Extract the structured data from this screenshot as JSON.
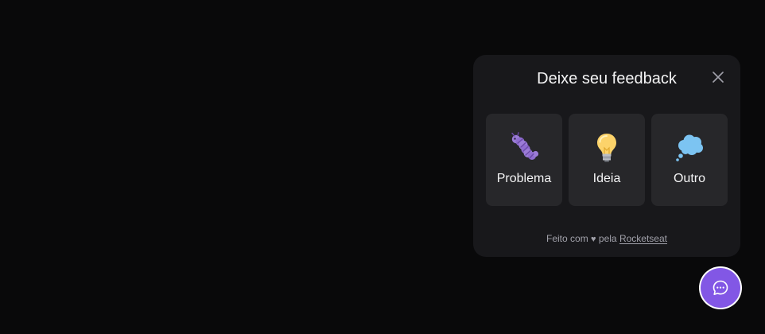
{
  "widget": {
    "title": "Deixe seu feedback",
    "close_icon": "close-icon",
    "options": [
      {
        "label": "Problema",
        "icon": "bug-icon"
      },
      {
        "label": "Ideia",
        "icon": "lightbulb-icon"
      },
      {
        "label": "Outro",
        "icon": "thought-bubble-icon"
      }
    ],
    "footer": {
      "prefix": "Feito com",
      "heart": "♥",
      "middle": "pela",
      "link": "Rocketseat"
    }
  },
  "fab": {
    "icon": "chat-icon"
  },
  "colors": {
    "background": "#09090a",
    "panel": "#18181b",
    "card": "#27272a",
    "brand": "#8257e5",
    "text": "#f4f4f5",
    "muted": "#a1a1aa"
  }
}
